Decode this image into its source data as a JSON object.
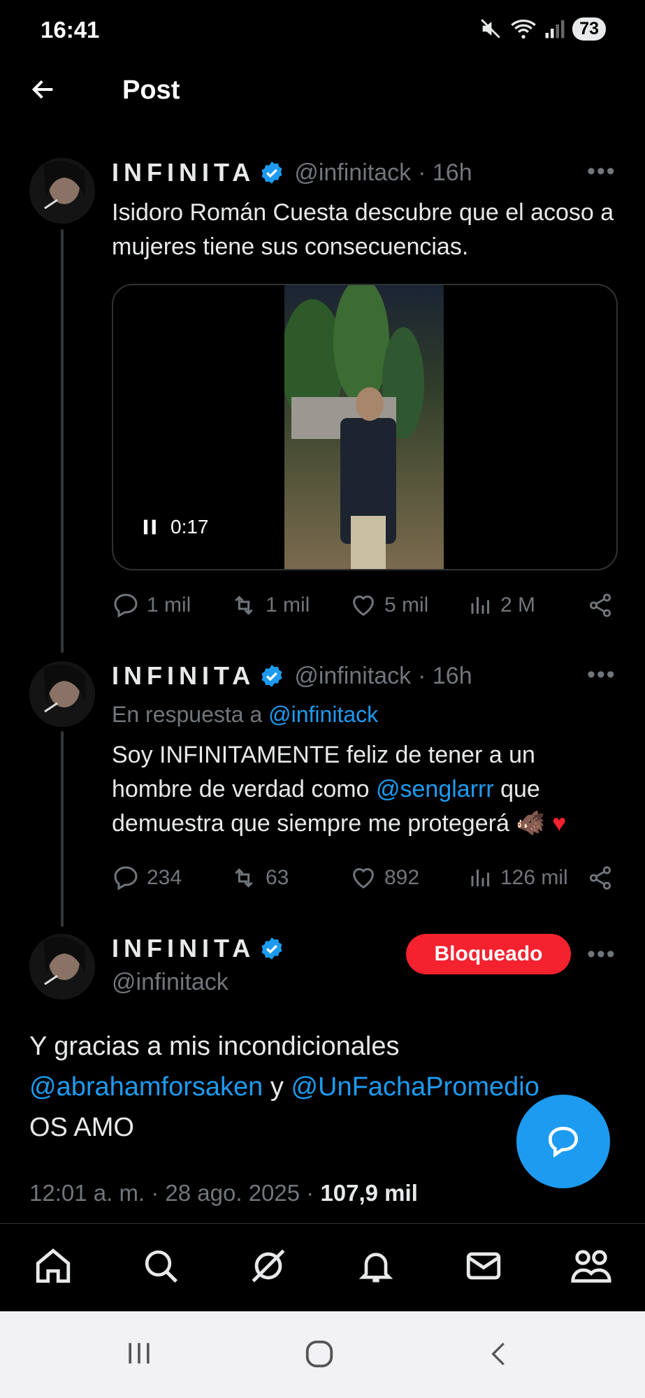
{
  "status": {
    "time": "16:41",
    "battery": "73"
  },
  "header": {
    "title": "Post"
  },
  "posts": [
    {
      "name": "INFINITA",
      "handle": "@infinitack",
      "time": "· 16h",
      "text": "Isidoro Román Cuesta descubre que el acoso a mujeres tiene sus consecuencias.",
      "video": {
        "duration": "0:17"
      },
      "stats": {
        "replies": "1 mil",
        "reposts": "1 mil",
        "likes": "5 mil",
        "views": "2 M"
      }
    },
    {
      "name": "INFINITA",
      "handle": "@infinitack",
      "time": "· 16h",
      "reply_prefix": "En respuesta a ",
      "reply_handle": "@infinitack",
      "text_a": "Soy INFINITAMENTE feliz de tener a un hombre de verdad como ",
      "mention": "@senglarrr",
      "text_b": " que demuestra que siempre me protegerá ",
      "emoji": "🐗",
      "heart": "♥",
      "stats": {
        "replies": "234",
        "reposts": "63",
        "likes": "892",
        "views": "126 mil"
      }
    }
  ],
  "focus_post": {
    "name": "INFINITA",
    "handle": "@infinitack",
    "badge": "Bloqueado",
    "line1": "Y gracias a mis incondicionales",
    "mention1": "@abrahamforsaken",
    "conj": " y ",
    "mention2": "@UnFachaPromedio",
    "line3": "OS AMO",
    "meta_time": "12:01 a. m. · 28 ago. 2025 · ",
    "views": "107,9 mil"
  },
  "colors": {
    "accent": "#1d9bf0",
    "blocked": "#f4212e",
    "muted": "#71767b"
  },
  "nav": [
    "home-icon",
    "search-icon",
    "grok-icon",
    "bell-icon",
    "mail-icon",
    "communities-icon"
  ]
}
